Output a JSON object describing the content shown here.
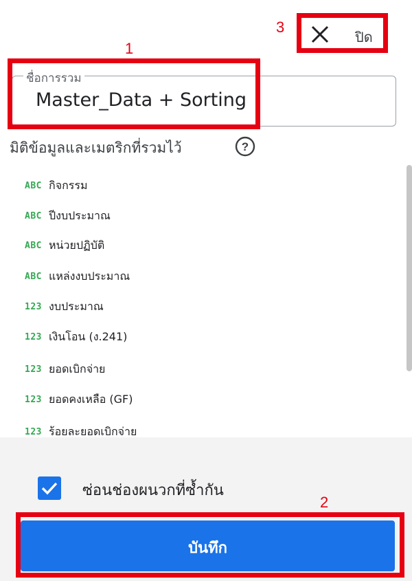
{
  "header": {
    "close_label": "ปิด",
    "close_icon": "close-icon"
  },
  "annotations": {
    "label_1": "1",
    "label_2": "2",
    "label_3": "3"
  },
  "name_field": {
    "label": "ชื่อการรวม",
    "value": "Master_Data + Sorting"
  },
  "section": {
    "title": "มิติข้อมูลและเมตริกที่รวมไว้",
    "help_icon": "help-icon"
  },
  "fields": [
    {
      "type": "ABC",
      "label": "กิจกรรม"
    },
    {
      "type": "ABC",
      "label": "ปีงบประมาณ"
    },
    {
      "type": "ABC",
      "label": "หน่วยปฏิบัติ"
    },
    {
      "type": "ABC",
      "label": "แหล่งงบประมาณ"
    },
    {
      "type": "123",
      "label": "งบประมาณ"
    },
    {
      "type": "123",
      "label": "เงินโอน (ง.241)"
    },
    {
      "type": "123",
      "label": "ยอดเบิกจ่าย"
    },
    {
      "type": "123",
      "label": "ยอดคงเหลือ (GF)"
    },
    {
      "type": "123",
      "label": "ร้อยละยอดเบิกจ่าย"
    }
  ],
  "options": {
    "hide_duplicate_label": "ซ่อนช่องผนวกที่ซ้ำกัน",
    "hide_duplicate_checked": true
  },
  "footer": {
    "save_label": "บันทึก"
  },
  "colors": {
    "accent": "#1a73e8",
    "annotation": "#e60012",
    "type_icon": "#34a853"
  }
}
